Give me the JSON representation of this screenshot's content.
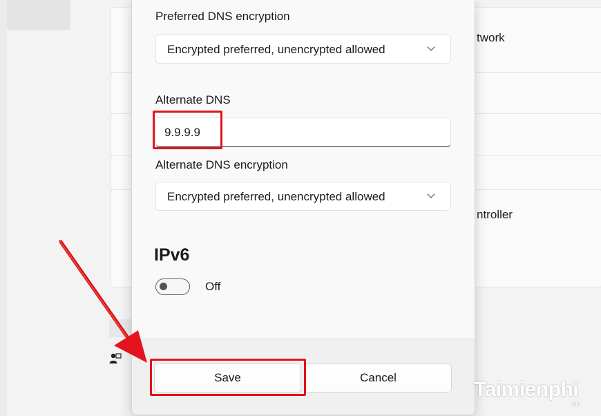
{
  "background": {
    "network_text": "twork",
    "controller_text": "ntroller"
  },
  "dialog": {
    "preferred_dns_encryption": {
      "label": "Preferred DNS encryption",
      "value": "Encrypted preferred, unencrypted allowed"
    },
    "alternate_dns": {
      "label": "Alternate DNS",
      "value": "9.9.9.9"
    },
    "alternate_dns_encryption": {
      "label": "Alternate DNS encryption",
      "value": "Encrypted preferred, unencrypted allowed"
    },
    "ipv6": {
      "title": "IPv6",
      "toggle_state": "Off"
    },
    "buttons": {
      "save": "Save",
      "cancel": "Cancel"
    }
  },
  "annotations": {
    "highlight_color": "#e0141b"
  },
  "watermark": {
    "brand": "Taimienphi",
    "suffix": ".vn"
  }
}
